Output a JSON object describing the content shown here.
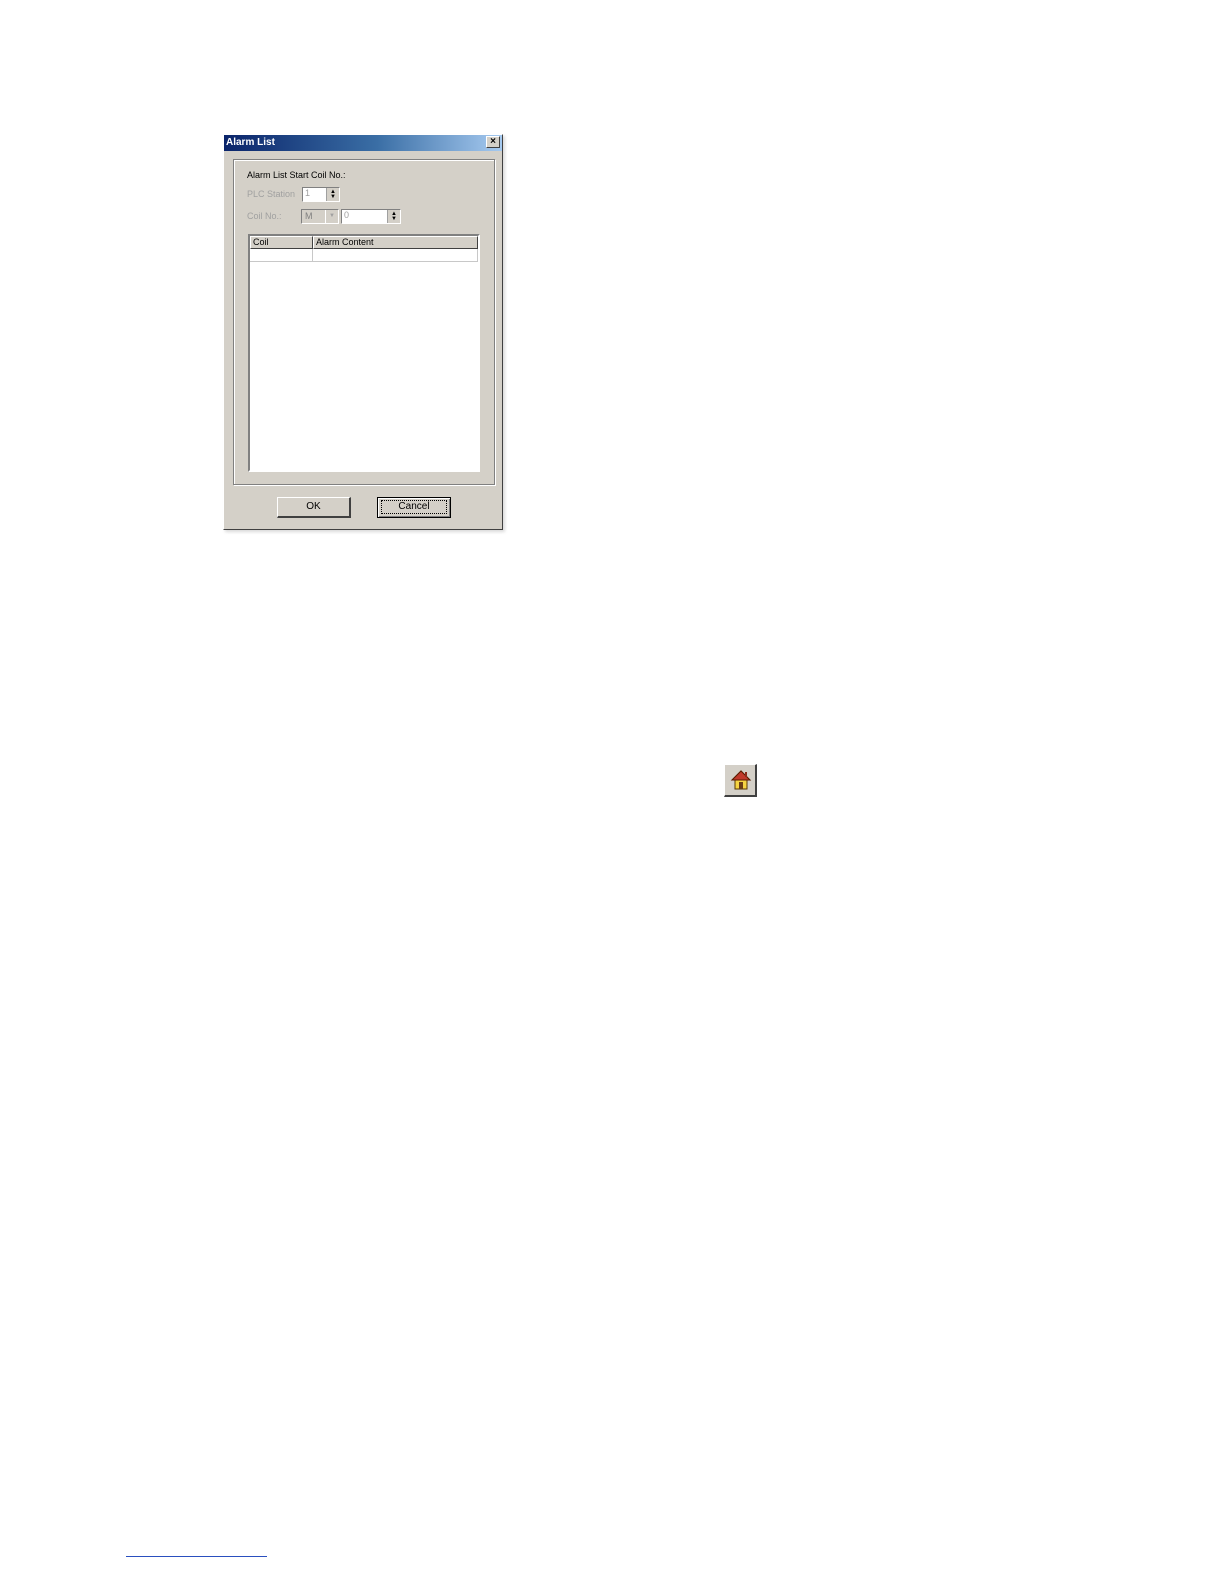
{
  "dialog": {
    "title": "Alarm List",
    "close_glyph": "×",
    "section_label": "Alarm List Start Coil No.:",
    "plc_station": {
      "label": "PLC Station",
      "value": "1"
    },
    "coil_no": {
      "label": "Coil No.:",
      "device": "M",
      "value": "0"
    },
    "table": {
      "columns": [
        "Coil",
        "Alarm Content"
      ],
      "rows": []
    },
    "ok_label": "OK",
    "cancel_label": "Cancel"
  },
  "icons": {
    "home": "home-icon",
    "close": "close-icon",
    "spin_up": "up-arrow-icon",
    "spin_down": "down-arrow-icon",
    "dropdown": "chevron-down-icon"
  },
  "colors": {
    "titlebar_start": "#0a246a",
    "titlebar_end": "#a6caf0",
    "dialog_bg": "#d4d0c8",
    "disabled_text": "#a0a0a0"
  }
}
